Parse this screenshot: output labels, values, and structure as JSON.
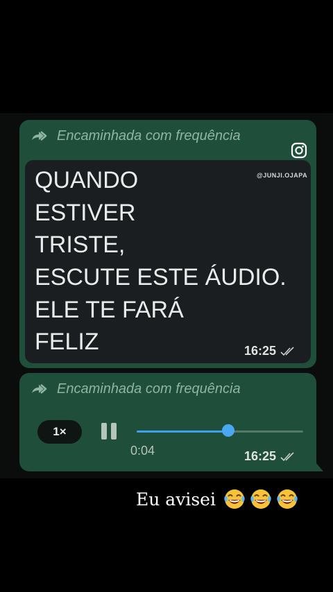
{
  "messages": [
    {
      "forward_label": "Encaminhada com frequência",
      "lines": [
        "QUANDO",
        "ESTIVER",
        "TRISTE,",
        "ESCUTE ESTE ÁUDIO.",
        "ELE TE FARÁ",
        "FELIZ"
      ],
      "time": "16:25"
    },
    {
      "forward_label": "Encaminhada com frequência",
      "speed": "1×",
      "elapsed": "0:04",
      "progress": 0.55,
      "time": "16:25"
    }
  ],
  "watermark": {
    "handle": "@JUNJI.OJAPA",
    "icon": "instagram-icon"
  },
  "caption": {
    "text": "Eu avisei",
    "emoji_count": 3,
    "emoji": "tears-of-joy-icon"
  },
  "colors": {
    "bubble": "#1f4f3b",
    "inner_card": "#1b1e20",
    "progress": "#4aa7f2",
    "forward_text": "#8fb3a4"
  }
}
